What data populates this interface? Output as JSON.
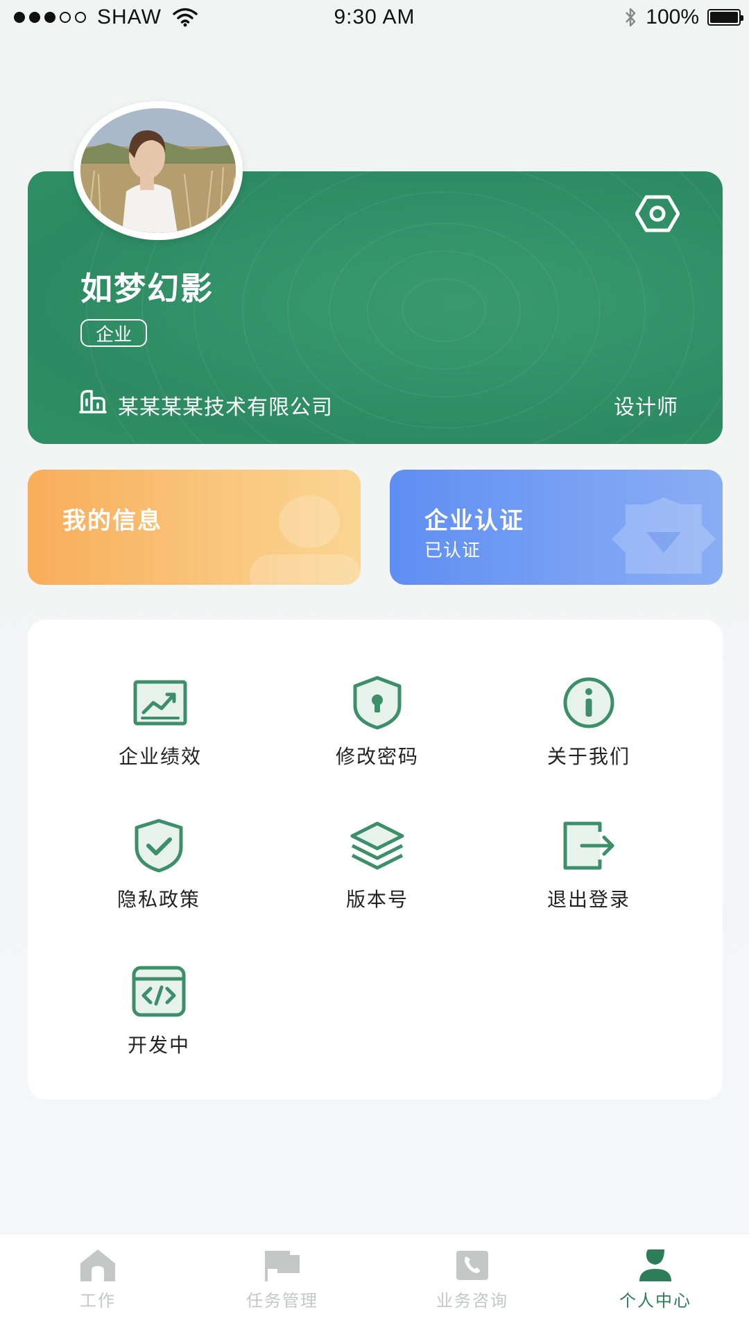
{
  "status_bar": {
    "carrier": "SHAW",
    "time": "9:30 AM",
    "battery": "100%"
  },
  "profile": {
    "name": "如梦幻影",
    "badge": "企业",
    "company": "某某某某技术有限公司",
    "job_title": "设计师"
  },
  "quick_cards": {
    "my_info": {
      "title": "我的信息"
    },
    "certification": {
      "title": "企业认证",
      "status": "已认证"
    }
  },
  "menu": [
    {
      "label": "企业绩效",
      "icon": "chart-icon"
    },
    {
      "label": "修改密码",
      "icon": "lock-shield-icon"
    },
    {
      "label": "关于我们",
      "icon": "info-icon"
    },
    {
      "label": "隐私政策",
      "icon": "shield-check-icon"
    },
    {
      "label": "版本号",
      "icon": "layers-icon"
    },
    {
      "label": "退出登录",
      "icon": "logout-icon"
    },
    {
      "label": "开发中",
      "icon": "code-icon"
    }
  ],
  "tabs": [
    {
      "label": "工作",
      "icon": "home-icon",
      "active": false
    },
    {
      "label": "任务管理",
      "icon": "flag-icon",
      "active": false
    },
    {
      "label": "业务咨询",
      "icon": "phone-icon",
      "active": false
    },
    {
      "label": "个人中心",
      "icon": "person-icon",
      "active": true
    }
  ],
  "colors": {
    "primary": "#2f8f64",
    "icon_green": "#3d8f69",
    "orange_card": "#f8ad5a",
    "blue_card": "#5f8ef2",
    "tab_inactive": "#c4c7c6",
    "tab_active": "#2c7d58"
  }
}
